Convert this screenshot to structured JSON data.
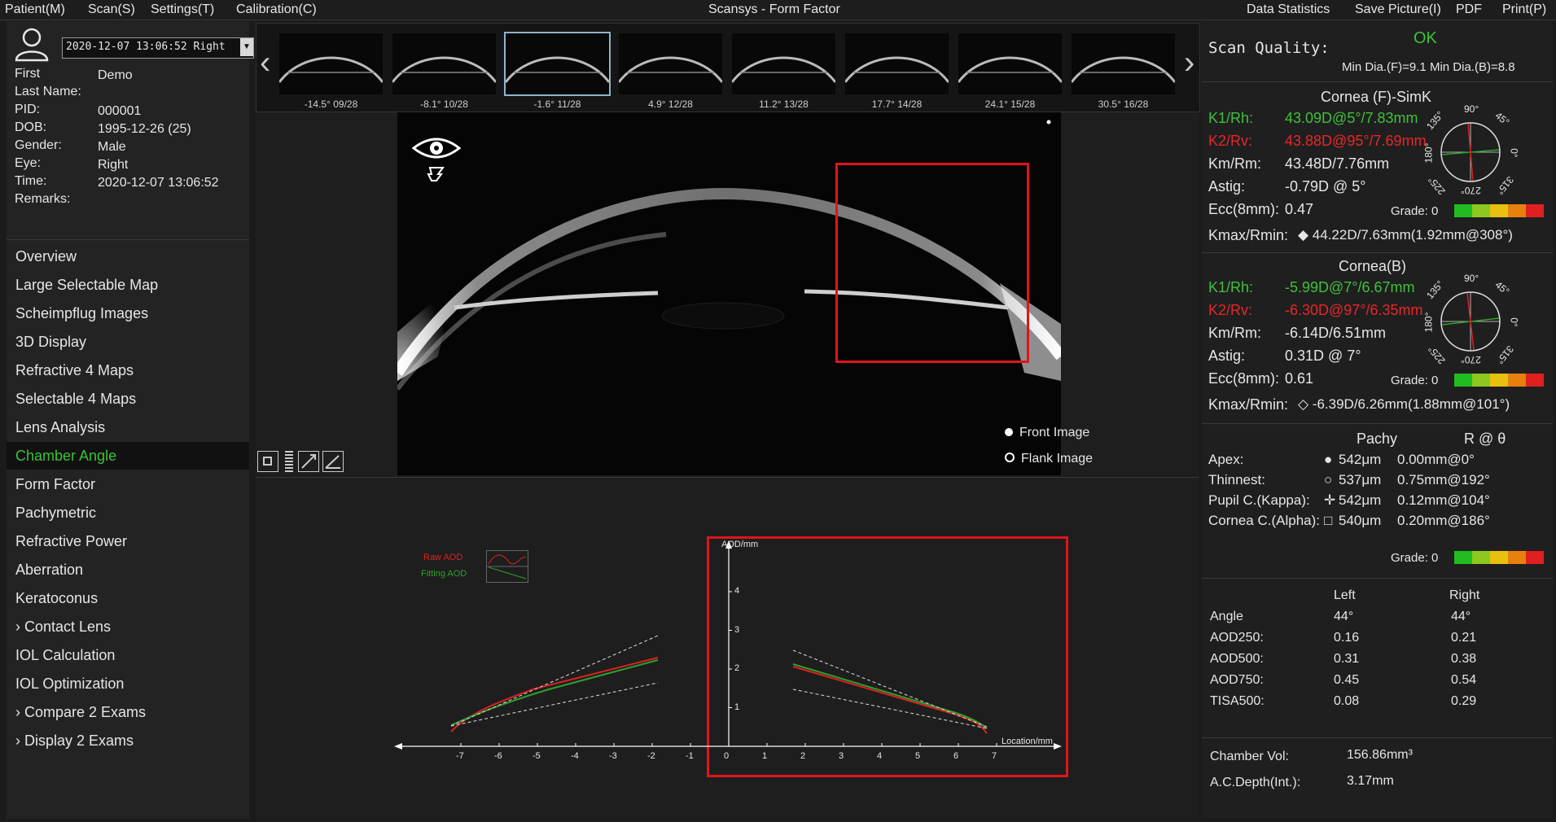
{
  "menu": {
    "patient": "Patient(M)",
    "scan": "Scan(S)",
    "settings": "Settings(T)",
    "calibration": "Calibration(C)",
    "title": "Scansys - Form Factor",
    "data_statistics": "Data Statistics",
    "save_picture": "Save Picture(I)",
    "pdf": "PDF",
    "print": "Print(P)"
  },
  "patient": {
    "exam_select": "2020-12-07 13:06:52 Right",
    "fields": [
      {
        "label": "First",
        "value": "Demo"
      },
      {
        "label": "Last Name:",
        "value": ""
      },
      {
        "label": "PID:",
        "value": "000001"
      },
      {
        "label": "DOB:",
        "value": "1995-12-26  (25)"
      },
      {
        "label": "Gender:",
        "value": "Male"
      },
      {
        "label": "Eye:",
        "value": "Right"
      },
      {
        "label": "Time:",
        "value": "2020-12-07 13:06:52"
      },
      {
        "label": "Remarks:",
        "value": ""
      }
    ]
  },
  "nav": [
    "Overview",
    "Large Selectable Map",
    "Scheimpflug Images",
    "3D Display",
    "Refractive 4 Maps",
    "Selectable 4 Maps",
    "Lens Analysis",
    "Chamber Angle",
    "Form Factor",
    "Pachymetric",
    "Refractive Power",
    "Aberration",
    "Keratoconus",
    "› Contact Lens",
    "IOL Calculation",
    "IOL Optimization",
    "› Compare 2 Exams",
    "› Display 2 Exams"
  ],
  "nav_active_index": 7,
  "thumbnails": [
    "-14.5° 09/28",
    "-8.1° 10/28",
    "-1.6° 11/28",
    "4.9° 12/28",
    "11.2° 13/28",
    "17.7° 14/28",
    "24.1° 15/28",
    "30.5° 16/28"
  ],
  "thumb_selected_index": 2,
  "image_options": {
    "front": "Front Image",
    "flank": "Flank Image"
  },
  "graph": {
    "legend_raw": "Raw AOD",
    "legend_fit": "Fitting AOD",
    "ylabel": "AOD/mm",
    "xlabel": "Location/mm",
    "xticks": [
      "-7",
      "-6",
      "-5",
      "-4",
      "-3",
      "-2",
      "-1",
      "0",
      "1",
      "2",
      "3",
      "4",
      "5",
      "6",
      "7"
    ],
    "yticks": [
      "1",
      "2",
      "3",
      "4"
    ]
  },
  "right": {
    "scan_quality_label": "Scan Quality:",
    "scan_quality_value": "OK",
    "min_dia": "Min Dia.(F)=9.1   Min Dia.(B)=8.8",
    "front": {
      "title": "Cornea (F)-SimK",
      "k1_label": "K1/Rh:",
      "k1_value": "43.09D@5°/7.83mm",
      "k2_label": "K2/Rv:",
      "k2_value": "43.88D@95°/7.69mm",
      "km_label": "Km/Rm:",
      "km_value": "43.48D/7.76mm",
      "astig_label": "Astig:",
      "astig_value": "-0.79D @ 5°",
      "ecc_label": "Ecc(8mm):",
      "ecc_value": "0.47",
      "grade": "Grade: 0",
      "kmax_label": "Kmax/Rmin:",
      "kmax_value": "◆ 44.22D/7.63mm(1.92mm@308°)"
    },
    "back": {
      "title": "Cornea(B)",
      "k1_label": "K1/Rh:",
      "k1_value": "-5.99D@7°/6.67mm",
      "k2_label": "K2/Rv:",
      "k2_value": "-6.30D@97°/6.35mm",
      "km_label": "Km/Rm:",
      "km_value": "-6.14D/6.51mm",
      "astig_label": "Astig:",
      "astig_value": "0.31D @ 7°",
      "ecc_label": "Ecc(8mm):",
      "ecc_value": "0.61",
      "grade": "Grade: 0",
      "kmax_label": "Kmax/Rmin:",
      "kmax_value": "◇ -6.39D/6.26mm(1.88mm@101°)"
    },
    "axis_labels": {
      "a90": "90°",
      "a45": "45°",
      "a135": "135°",
      "a180": "180°",
      "a0": "0°",
      "a225": "225°",
      "a270": "270°",
      "a315": "315°"
    },
    "pachy": {
      "col_pachy": "Pachy",
      "col_r": "R @ θ",
      "rows": [
        {
          "label": "Apex:",
          "symbol": "●",
          "pachy": "542μm",
          "r": "0.00mm@0°"
        },
        {
          "label": "Thinnest:",
          "symbol": "○",
          "pachy": "537μm",
          "r": "0.75mm@192°"
        },
        {
          "label": "Pupil C.(Kappa):",
          "symbol": "✛",
          "pachy": "542μm",
          "r": "0.12mm@104°"
        },
        {
          "label": "Cornea C.(Alpha):",
          "symbol": "□",
          "pachy": "540μm",
          "r": "0.20mm@186°"
        }
      ],
      "grade": "Grade: 0"
    },
    "angle": {
      "col_left": "Left",
      "col_right": "Right",
      "rows": [
        {
          "label": "Angle",
          "left": "44°",
          "right": "44°"
        },
        {
          "label": "AOD250:",
          "left": "0.16",
          "right": "0.21"
        },
        {
          "label": "AOD500:",
          "left": "0.31",
          "right": "0.38"
        },
        {
          "label": "AOD750:",
          "left": "0.45",
          "right": "0.54"
        },
        {
          "label": "TISA500:",
          "left": "0.08",
          "right": "0.29"
        }
      ]
    },
    "chamber_vol_label": "Chamber Vol:",
    "chamber_vol_value": "156.86mm³",
    "acd_label": "A.C.Depth(Int.):",
    "acd_value": "3.17mm"
  }
}
